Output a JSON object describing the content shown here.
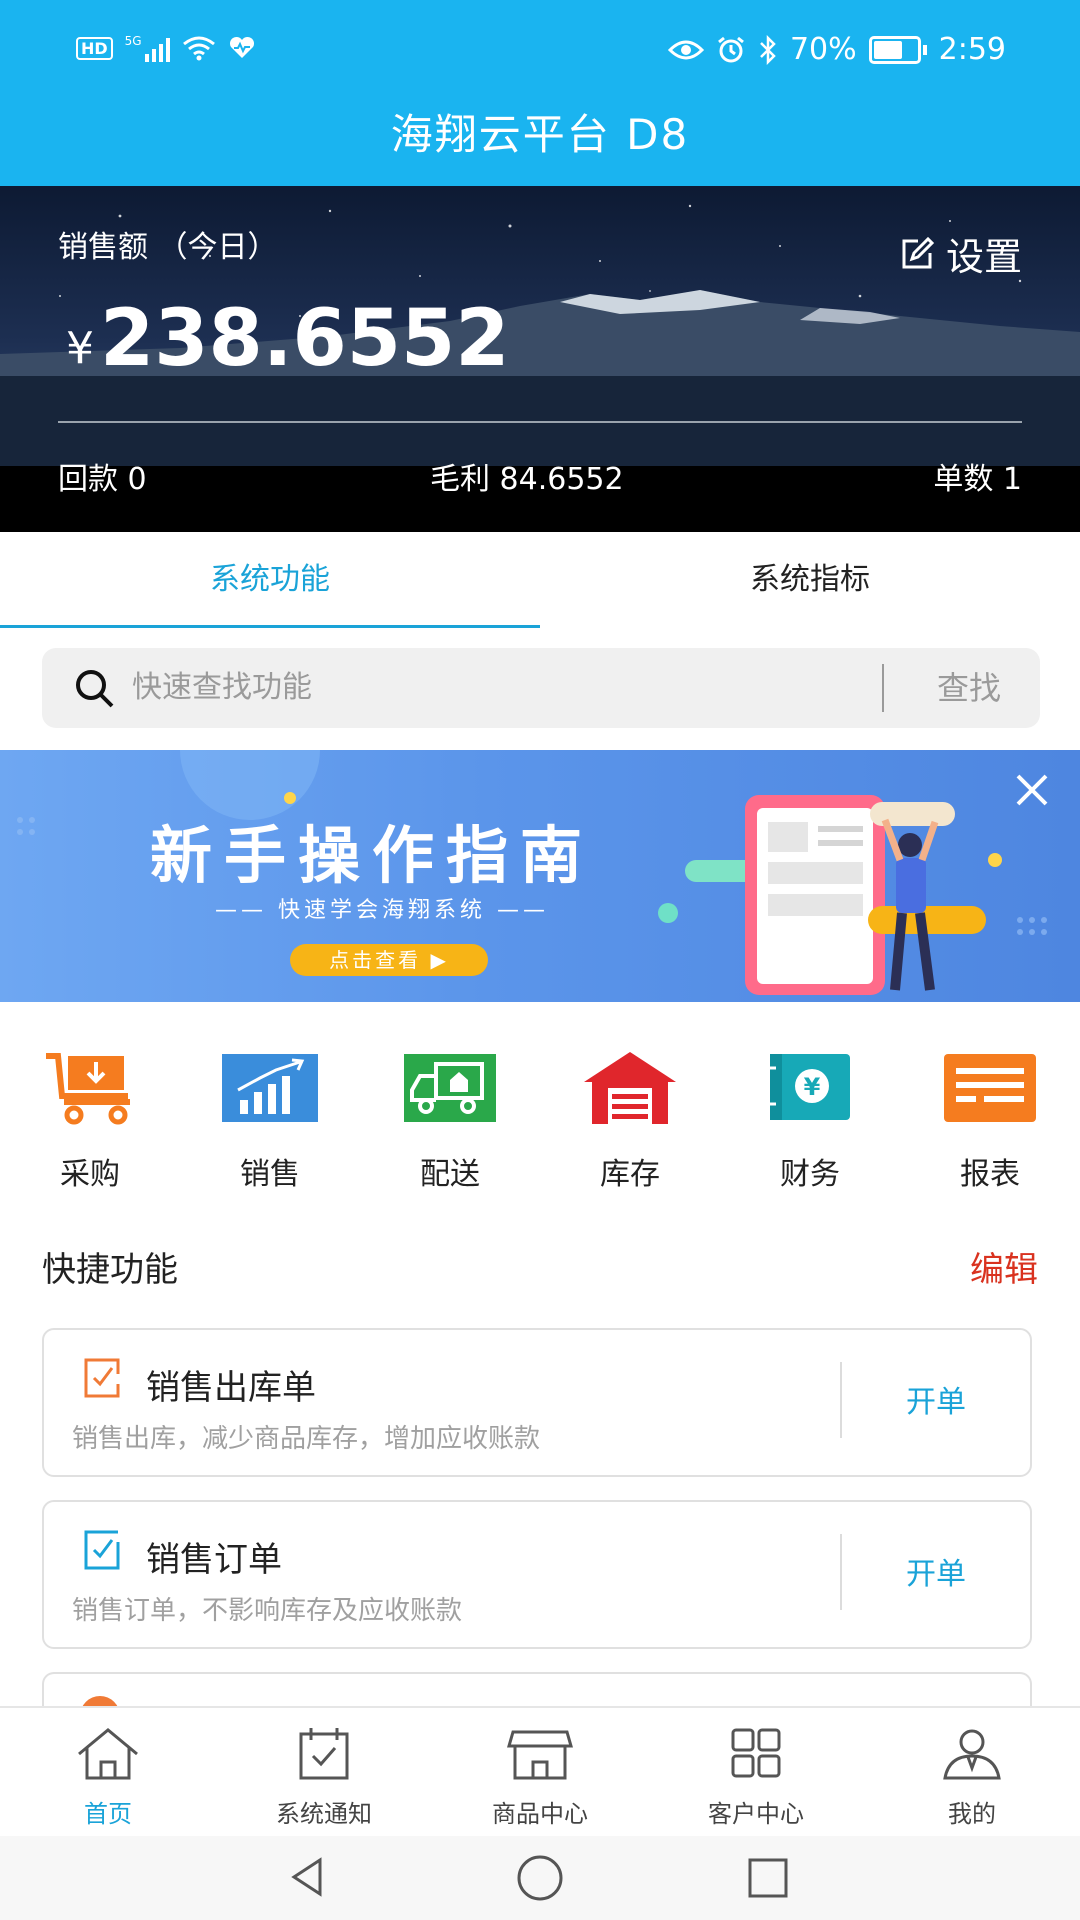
{
  "status_bar": {
    "network_badge": "HD",
    "signal_label": "5G",
    "battery": "70%",
    "time": "2:59"
  },
  "header": {
    "title": "海翔云平台 D8"
  },
  "hero": {
    "sales_label": "销售额 （今日）",
    "settings_label": "设置",
    "currency": "¥",
    "amount": "238.6552",
    "stats": [
      {
        "label": "回款 0"
      },
      {
        "label": "毛利 84.6552"
      },
      {
        "label": "单数 1"
      }
    ]
  },
  "tabs": [
    {
      "label": "系统功能",
      "active": true
    },
    {
      "label": "系统指标",
      "active": false
    }
  ],
  "search": {
    "placeholder": "快速查找功能",
    "button": "查找"
  },
  "banner": {
    "title": "新手操作指南",
    "subtitle": "—— 快速学会海翔系统 ——",
    "cta": "点击查看 ▶"
  },
  "modules": [
    {
      "label": "采购",
      "icon": "cart-icon",
      "color": "#f57c1f"
    },
    {
      "label": "销售",
      "icon": "chart-icon",
      "color": "#3a8ddb"
    },
    {
      "label": "配送",
      "icon": "truck-icon",
      "color": "#2aa84a"
    },
    {
      "label": "库存",
      "icon": "warehouse-icon",
      "color": "#e0262c"
    },
    {
      "label": "财务",
      "icon": "finance-icon",
      "color": "#17a9b7"
    },
    {
      "label": "报表",
      "icon": "report-icon",
      "color": "#f57c1f"
    }
  ],
  "quick": {
    "title": "快捷功能",
    "edit": "编辑",
    "items": [
      {
        "name": "销售出库单",
        "desc": "销售出库，减少商品库存，增加应收账款",
        "action": "开单",
        "icon": "outbound-doc-icon"
      },
      {
        "name": "销售订单",
        "desc": "销售订单，不影响库存及应收账款",
        "action": "开单",
        "icon": "order-doc-icon"
      }
    ]
  },
  "bottom_nav": [
    {
      "label": "首页",
      "icon": "home-icon",
      "active": true
    },
    {
      "label": "系统通知",
      "icon": "calendar-check-icon",
      "active": false
    },
    {
      "label": "商品中心",
      "icon": "store-icon",
      "active": false
    },
    {
      "label": "客户中心",
      "icon": "grid-icon",
      "active": false
    },
    {
      "label": "我的",
      "icon": "person-icon",
      "active": false
    }
  ],
  "colors": {
    "primary": "#1ab4f0",
    "accent_blue": "#1aa3d8",
    "edit_red": "#d9321f"
  }
}
